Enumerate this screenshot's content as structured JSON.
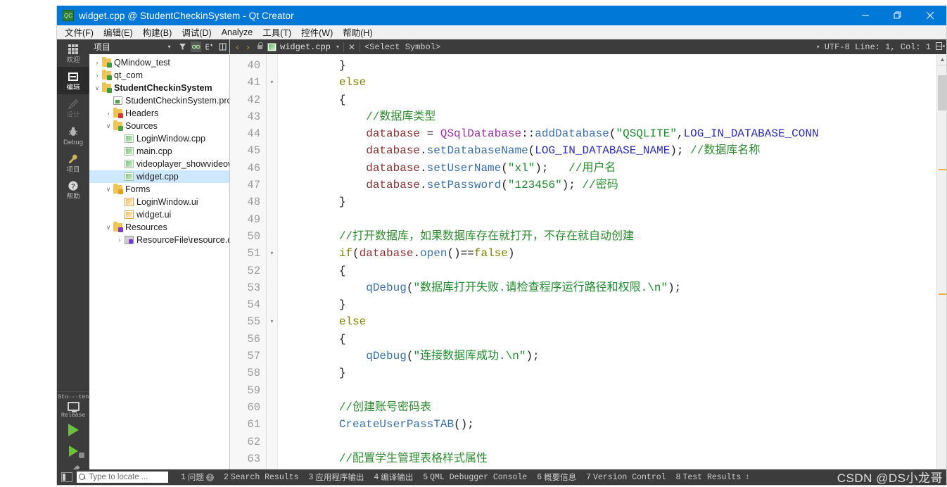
{
  "window": {
    "title": "widget.cpp @ StudentCheckinSystem - Qt Creator",
    "icon": "qt-creator-icon",
    "minimize": "–",
    "restore": "❐",
    "close": "✕",
    "accent_color": "#0078d7"
  },
  "menubar": {
    "items": [
      {
        "label": "文件(F)"
      },
      {
        "label": "编辑(E)"
      },
      {
        "label": "构建(B)"
      },
      {
        "label": "调试(D)"
      },
      {
        "label": "Analyze"
      },
      {
        "label": "工具(T)"
      },
      {
        "label": "控件(W)"
      },
      {
        "label": "帮助(H)"
      }
    ]
  },
  "mode_rail": {
    "modes": [
      {
        "label": "欢迎",
        "icon": "welcome-grid-icon",
        "active": false,
        "dim": false
      },
      {
        "label": "编辑",
        "icon": "edit-icon",
        "active": true,
        "dim": false
      },
      {
        "label": "设计",
        "icon": "design-pencil-icon",
        "active": false,
        "dim": true
      },
      {
        "label": "Debug",
        "icon": "debug-bug-icon",
        "active": false,
        "dim": false
      },
      {
        "label": "项目",
        "icon": "projects-wrench-icon",
        "active": false,
        "dim": false
      },
      {
        "label": "帮助",
        "icon": "help-question-icon",
        "active": false,
        "dim": false
      }
    ],
    "kit_name": "Stu···ten",
    "build_config": "Release",
    "run_button": "run-icon",
    "debug_button": "start-debugging-icon",
    "build_button": "build-hammer-icon"
  },
  "project_panel": {
    "title": "项目",
    "toolbar": [
      {
        "icon": "filter-icon",
        "active": false
      },
      {
        "icon": "link-sync-icon",
        "active": true
      },
      {
        "icon": "expand-tree-icon",
        "active": false
      },
      {
        "icon": "split-icon",
        "active": false
      }
    ],
    "tree": [
      {
        "depth": 0,
        "arrow": "›",
        "icon": "project-folder",
        "label": "QMindow_test",
        "bold": false,
        "selected": false
      },
      {
        "depth": 0,
        "arrow": "›",
        "icon": "project-folder",
        "label": "qt_com",
        "bold": false,
        "selected": false
      },
      {
        "depth": 0,
        "arrow": "∨",
        "icon": "project-folder",
        "label": "StudentCheckinSystem",
        "bold": true,
        "selected": false
      },
      {
        "depth": 1,
        "arrow": "",
        "icon": "pro-file",
        "label": "StudentCheckinSystem.pro",
        "bold": false,
        "selected": false
      },
      {
        "depth": 1,
        "arrow": "›",
        "icon": "headers-folder",
        "label": "Headers",
        "bold": false,
        "selected": false
      },
      {
        "depth": 1,
        "arrow": "∨",
        "icon": "sources-folder",
        "label": "Sources",
        "bold": false,
        "selected": false
      },
      {
        "depth": 2,
        "arrow": "",
        "icon": "cpp-file",
        "label": "LoginWindow.cpp",
        "bold": false,
        "selected": false
      },
      {
        "depth": 2,
        "arrow": "",
        "icon": "cpp-file",
        "label": "main.cpp",
        "bold": false,
        "selected": false
      },
      {
        "depth": 2,
        "arrow": "",
        "icon": "cpp-file",
        "label": "videoplayer_showvideow",
        "bold": false,
        "selected": false
      },
      {
        "depth": 2,
        "arrow": "",
        "icon": "cpp-file",
        "label": "widget.cpp",
        "bold": false,
        "selected": true
      },
      {
        "depth": 1,
        "arrow": "∨",
        "icon": "forms-folder",
        "label": "Forms",
        "bold": false,
        "selected": false
      },
      {
        "depth": 2,
        "arrow": "",
        "icon": "ui-file",
        "label": "LoginWindow.ui",
        "bold": false,
        "selected": false
      },
      {
        "depth": 2,
        "arrow": "",
        "icon": "ui-file",
        "label": "widget.ui",
        "bold": false,
        "selected": false
      },
      {
        "depth": 1,
        "arrow": "∨",
        "icon": "resources-folder",
        "label": "Resources",
        "bold": false,
        "selected": false
      },
      {
        "depth": 2,
        "arrow": "›",
        "icon": "qrc-file",
        "label": "ResourceFile\\resource.qrc",
        "bold": false,
        "selected": false
      }
    ]
  },
  "editor": {
    "toolbar": {
      "back": "‹",
      "forward": "›",
      "lock": "lock-icon",
      "filename": "widget.cpp",
      "file_dropdown_arrow": "▾",
      "close_label": "✕",
      "symbol_selector": "<Select Symbol>",
      "symbol_dropdown_arrow": "▾",
      "encoding_and_pos": "UTF-8 Line: 1, Col: 1",
      "split_button": "split-editor-icon"
    },
    "first_line_number": 40,
    "lines": [
      {
        "n": 40,
        "fold": "",
        "tokens": [
          {
            "t": "        }",
            "c": "pl"
          }
        ]
      },
      {
        "n": 41,
        "fold": "▾",
        "tokens": [
          {
            "t": "        ",
            "c": "pl"
          },
          {
            "t": "else",
            "c": "key"
          }
        ]
      },
      {
        "n": 42,
        "fold": "",
        "tokens": [
          {
            "t": "        {",
            "c": "pl"
          }
        ]
      },
      {
        "n": 43,
        "fold": "",
        "tokens": [
          {
            "t": "            ",
            "c": "pl"
          },
          {
            "t": "//数据库类型",
            "c": "cmt"
          }
        ]
      },
      {
        "n": 44,
        "fold": "",
        "tokens": [
          {
            "t": "            ",
            "c": "pl"
          },
          {
            "t": "database",
            "c": "var"
          },
          {
            "t": " = ",
            "c": "op"
          },
          {
            "t": "QSqlDatabase",
            "c": "cls"
          },
          {
            "t": "::",
            "c": "op"
          },
          {
            "t": "addDatabase",
            "c": "fn"
          },
          {
            "t": "(",
            "c": "op"
          },
          {
            "t": "\"QSQLITE\"",
            "c": "str"
          },
          {
            "t": ",",
            "c": "op"
          },
          {
            "t": "LOG_IN_DATABASE_CONN",
            "c": "mac"
          }
        ]
      },
      {
        "n": 45,
        "fold": "",
        "tokens": [
          {
            "t": "            ",
            "c": "pl"
          },
          {
            "t": "database",
            "c": "var"
          },
          {
            "t": ".",
            "c": "op"
          },
          {
            "t": "setDatabaseName",
            "c": "fn"
          },
          {
            "t": "(",
            "c": "op"
          },
          {
            "t": "LOG_IN_DATABASE_NAME",
            "c": "mac"
          },
          {
            "t": "); ",
            "c": "op"
          },
          {
            "t": "//数据库名称",
            "c": "cmt"
          }
        ]
      },
      {
        "n": 46,
        "fold": "",
        "tokens": [
          {
            "t": "            ",
            "c": "pl"
          },
          {
            "t": "database",
            "c": "var"
          },
          {
            "t": ".",
            "c": "op"
          },
          {
            "t": "setUserName",
            "c": "fn"
          },
          {
            "t": "(",
            "c": "op"
          },
          {
            "t": "\"xl\"",
            "c": "str"
          },
          {
            "t": ");   ",
            "c": "op"
          },
          {
            "t": "//用户名",
            "c": "cmt"
          }
        ]
      },
      {
        "n": 47,
        "fold": "",
        "tokens": [
          {
            "t": "            ",
            "c": "pl"
          },
          {
            "t": "database",
            "c": "var"
          },
          {
            "t": ".",
            "c": "op"
          },
          {
            "t": "setPassword",
            "c": "fn"
          },
          {
            "t": "(",
            "c": "op"
          },
          {
            "t": "\"123456\"",
            "c": "str"
          },
          {
            "t": "); ",
            "c": "op"
          },
          {
            "t": "//密码",
            "c": "cmt"
          }
        ]
      },
      {
        "n": 48,
        "fold": "",
        "tokens": [
          {
            "t": "        }",
            "c": "pl"
          }
        ]
      },
      {
        "n": 49,
        "fold": "",
        "tokens": [
          {
            "t": "",
            "c": "pl"
          }
        ]
      },
      {
        "n": 50,
        "fold": "",
        "tokens": [
          {
            "t": "        ",
            "c": "pl"
          },
          {
            "t": "//打开数据库，如果数据库存在就打开，不存在就自动创建",
            "c": "cmt"
          }
        ]
      },
      {
        "n": 51,
        "fold": "▾",
        "tokens": [
          {
            "t": "        ",
            "c": "pl"
          },
          {
            "t": "if",
            "c": "key"
          },
          {
            "t": "(",
            "c": "op"
          },
          {
            "t": "database",
            "c": "var"
          },
          {
            "t": ".",
            "c": "op"
          },
          {
            "t": "open",
            "c": "fn"
          },
          {
            "t": "()==",
            "c": "op"
          },
          {
            "t": "false",
            "c": "key"
          },
          {
            "t": ")",
            "c": "op"
          }
        ]
      },
      {
        "n": 52,
        "fold": "",
        "tokens": [
          {
            "t": "        {",
            "c": "pl"
          }
        ]
      },
      {
        "n": 53,
        "fold": "",
        "tokens": [
          {
            "t": "            ",
            "c": "pl"
          },
          {
            "t": "qDebug",
            "c": "fn"
          },
          {
            "t": "(",
            "c": "op"
          },
          {
            "t": "\"数据库打开失败.请检查程序运行路径和权限.\\n\"",
            "c": "str"
          },
          {
            "t": ");",
            "c": "op"
          }
        ]
      },
      {
        "n": 54,
        "fold": "",
        "tokens": [
          {
            "t": "        }",
            "c": "pl"
          }
        ]
      },
      {
        "n": 55,
        "fold": "▾",
        "tokens": [
          {
            "t": "        ",
            "c": "pl"
          },
          {
            "t": "else",
            "c": "key"
          }
        ]
      },
      {
        "n": 56,
        "fold": "",
        "tokens": [
          {
            "t": "        {",
            "c": "pl"
          }
        ]
      },
      {
        "n": 57,
        "fold": "",
        "tokens": [
          {
            "t": "            ",
            "c": "pl"
          },
          {
            "t": "qDebug",
            "c": "fn"
          },
          {
            "t": "(",
            "c": "op"
          },
          {
            "t": "\"连接数据库成功.\\n\"",
            "c": "str"
          },
          {
            "t": ");",
            "c": "op"
          }
        ]
      },
      {
        "n": 58,
        "fold": "",
        "tokens": [
          {
            "t": "        }",
            "c": "pl"
          }
        ]
      },
      {
        "n": 59,
        "fold": "",
        "tokens": [
          {
            "t": "",
            "c": "pl"
          }
        ]
      },
      {
        "n": 60,
        "fold": "",
        "tokens": [
          {
            "t": "        ",
            "c": "pl"
          },
          {
            "t": "//创建账号密码表",
            "c": "cmt"
          }
        ]
      },
      {
        "n": 61,
        "fold": "",
        "tokens": [
          {
            "t": "        ",
            "c": "pl"
          },
          {
            "t": "CreateUserPassTAB",
            "c": "fn"
          },
          {
            "t": "();",
            "c": "op"
          }
        ]
      },
      {
        "n": 62,
        "fold": "",
        "tokens": [
          {
            "t": "",
            "c": "pl"
          }
        ]
      },
      {
        "n": 63,
        "fold": "",
        "tokens": [
          {
            "t": "        ",
            "c": "pl"
          },
          {
            "t": "//配置学生管理表格样式属性",
            "c": "cmt"
          }
        ]
      }
    ]
  },
  "statusbar": {
    "toggle_sidebar": "toggle-sidebar-icon",
    "locator_placeholder": "Type to locate ...",
    "panes": [
      {
        "num": "1",
        "label": "问题",
        "badge": "2",
        "cn": true
      },
      {
        "num": "2",
        "label": "Search Results",
        "badge": "",
        "cn": false
      },
      {
        "num": "3",
        "label": "应用程序输出",
        "badge": "",
        "cn": true
      },
      {
        "num": "4",
        "label": "编译输出",
        "badge": "",
        "cn": true
      },
      {
        "num": "5",
        "label": "QML Debugger Console",
        "badge": "",
        "cn": false
      },
      {
        "num": "6",
        "label": "概要信息",
        "badge": "",
        "cn": true
      },
      {
        "num": "7",
        "label": "Version Control",
        "badge": "",
        "cn": false
      },
      {
        "num": "8",
        "label": "Test Results",
        "badge": "",
        "cn": false
      }
    ],
    "updown": "↕"
  },
  "watermark": {
    "text": "CSDN @DS小龙哥"
  }
}
